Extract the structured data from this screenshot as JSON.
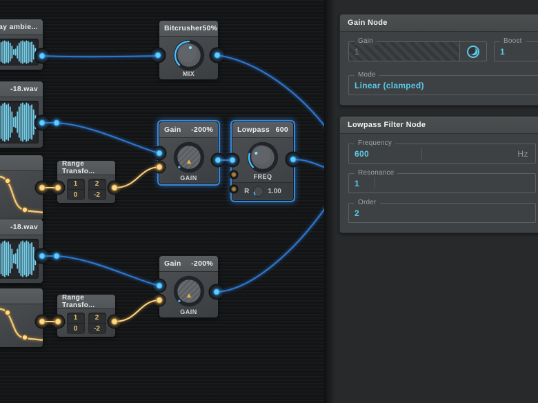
{
  "canvas": {
    "nodes": {
      "sample1": {
        "title": "ray ambie..."
      },
      "sample2": {
        "title": "-18.wav"
      },
      "curve1": {
        "title": ""
      },
      "sample3": {
        "title": "-18.wav"
      },
      "curve2": {
        "title": ""
      },
      "bitcrusher": {
        "title": "Bitcrusher",
        "value": "50%",
        "knob_label": "MIX"
      },
      "gain1": {
        "title": "Gain",
        "value": "-200%",
        "knob_label": "GAIN"
      },
      "gain2": {
        "title": "Gain",
        "value": "-200%",
        "knob_label": "GAIN"
      },
      "lowpass": {
        "title": "Lowpass",
        "value": "600",
        "knob_label": "FREQ",
        "r_label": "R",
        "r_value": "1.00"
      },
      "range1": {
        "title": "Range Transfo...",
        "in_top": "1",
        "in_bottom": "0",
        "out_top": "2",
        "out_bottom": "-2"
      },
      "range2": {
        "title": "Range Transfo...",
        "in_top": "1",
        "in_bottom": "0",
        "out_top": "2",
        "out_bottom": "-2"
      }
    },
    "waveform_bars": [
      0.5,
      0.75,
      0.9,
      0.7,
      0.95,
      1,
      0.85,
      0.95,
      1,
      0.9,
      0.95,
      0.8,
      0.55,
      0.25,
      0.3,
      0.55,
      0.8,
      0.95,
      1,
      0.9,
      1,
      0.95,
      0.85,
      0.9,
      0.65,
      0.35
    ]
  },
  "panel": {
    "gain_card": {
      "title": "Gain Node",
      "fields": {
        "gain": {
          "label": "Gain",
          "value": "1"
        },
        "boost": {
          "label": "Boost",
          "value": "1"
        },
        "mode": {
          "label": "Mode",
          "value": "Linear (clamped)"
        }
      }
    },
    "lowpass_card": {
      "title": "Lowpass Filter Node",
      "fields": {
        "frequency": {
          "label": "Frequency",
          "value": "600",
          "unit": "Hz"
        },
        "resonance": {
          "label": "Resonance",
          "value": "1"
        },
        "order": {
          "label": "Order",
          "value": "2"
        }
      }
    }
  },
  "colors": {
    "wire_blue": "#2f77cd",
    "wire_yellow": "#f7d186",
    "port_blue": "#62cdff",
    "port_yellow": "#ffd98c",
    "value_cyan": "#58cbe8",
    "waveform_cyan": "#74cde8",
    "selection_blue": "#3e8ede"
  }
}
